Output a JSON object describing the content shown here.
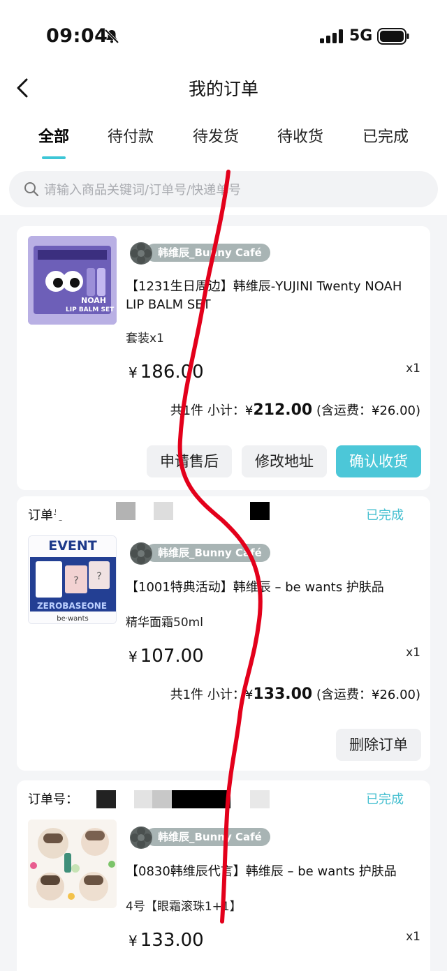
{
  "status_bar": {
    "time": "09:04",
    "network": "5G"
  },
  "nav": {
    "title": "我的订单"
  },
  "tabs": [
    {
      "label": "全部",
      "active": true
    },
    {
      "label": "待付款",
      "active": false
    },
    {
      "label": "待发货",
      "active": false
    },
    {
      "label": "待收货",
      "active": false
    },
    {
      "label": "已完成",
      "active": false
    }
  ],
  "search": {
    "placeholder": "请输入商品关键词/订单号/快递单号"
  },
  "orders": [
    {
      "shop": "韩维辰_Bunny Café",
      "product": "【1231生日周边】韩维辰-YUJINI Twenty NOAH LIP BALM SET",
      "spec": "套装x1",
      "price": "186.00",
      "qty": "x1",
      "subtotal_prefix": "共1件 小计：¥",
      "subtotal": "212.00",
      "shipping_note": "(含运费：¥26.00)",
      "buttons": [
        "申请售后",
        "修改地址",
        "确认收货"
      ],
      "thumb_text": [
        "NOAH",
        "LIP BALM SET"
      ]
    },
    {
      "order_label": "订单号",
      "status": "已完成",
      "shop": "韩维辰_Bunny Café",
      "product": "【1001特典活动】韩维辰 – be wants 护肤品",
      "spec": "精华面霜50ml",
      "price": "107.00",
      "qty": "x1",
      "subtotal_prefix": "共1件 小计：¥",
      "subtotal": "133.00",
      "shipping_note": "(含运费：¥26.00)",
      "buttons": [
        "删除订单"
      ],
      "thumb_text": [
        "EVENT",
        "ZEROBASEONE",
        "be·wants"
      ]
    },
    {
      "order_label": "订单号：",
      "status": "已完成",
      "shop": "韩维辰_Bunny Café",
      "product": "【0830韩维辰代言】韩维辰 – be wants 护肤品",
      "spec": "4号【眼霜滚珠1+1】",
      "price": "133.00",
      "qty": "x1"
    }
  ],
  "colors": {
    "accent": "#4cc7d8",
    "status": "#45bfd0",
    "shop_badge": "#a8b4b4",
    "annotation": "#e3001b"
  }
}
